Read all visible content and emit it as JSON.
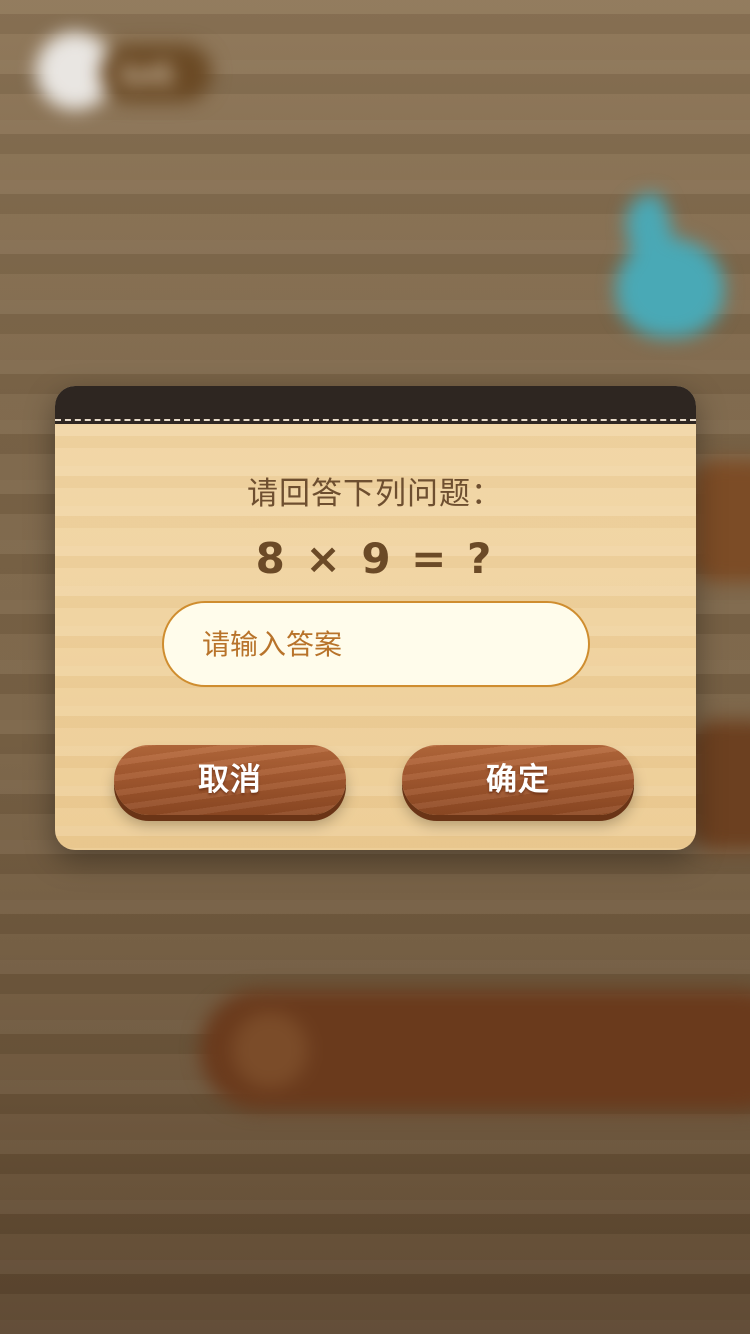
{
  "background": {
    "level_badge_text": "Lv1"
  },
  "dialog": {
    "prompt": "请回答下列问题：",
    "question": "8 × 9 = ?",
    "answer_input": {
      "value": "",
      "placeholder": "请输入答案"
    },
    "buttons": {
      "cancel_label": "取消",
      "confirm_label": "确定"
    }
  },
  "colors": {
    "header": "#2e2621",
    "panel_wood": "#f0d39f",
    "button_wood": "#a65a30",
    "input_border": "#cf8d2f",
    "text_brown": "#6b4a27"
  }
}
